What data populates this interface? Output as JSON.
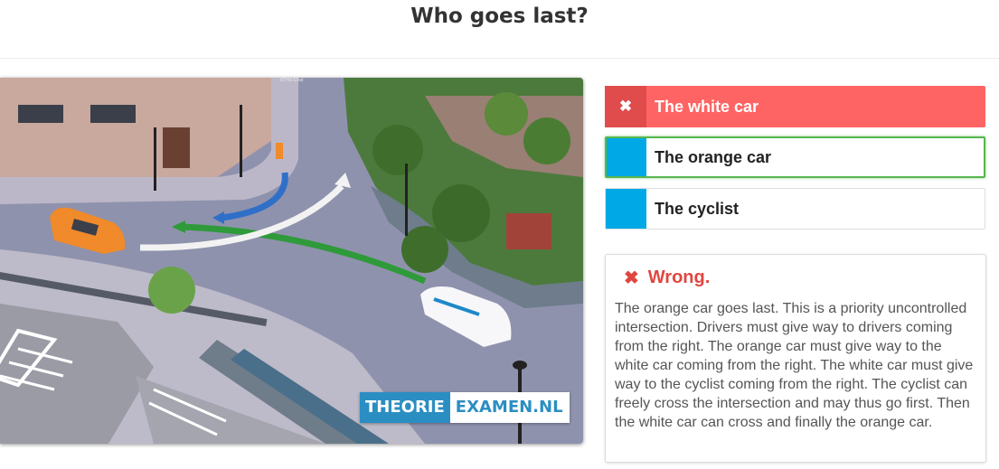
{
  "question": {
    "title": "Who goes last?"
  },
  "scene": {
    "caption": "©THX-Chat",
    "watermark_a": "THEORIE",
    "watermark_b": "EXAMEN.NL"
  },
  "answers": [
    {
      "label": "The white car",
      "mark": "✖",
      "state": "selected-wrong"
    },
    {
      "label": "The orange car",
      "mark": "",
      "state": "correct"
    },
    {
      "label": "The cyclist",
      "mark": "",
      "state": "default"
    }
  ],
  "feedback": {
    "icon": "✖",
    "title": "Wrong.",
    "text": "The orange car goes last. This is a priority uncontrolled intersection. Drivers must give way to drivers coming from the right. The orange car must give way to the white car coming from the right. The white car must give way to the cyclist coming from the right. The cyclist can freely cross the intersection and may thus go first. Then the white car can cross and finally the orange car."
  },
  "colors": {
    "wrong": "#fe6463",
    "correct_border": "#56b64e",
    "marker_blue": "#00a9e6",
    "feedback_red": "#e0463f"
  }
}
